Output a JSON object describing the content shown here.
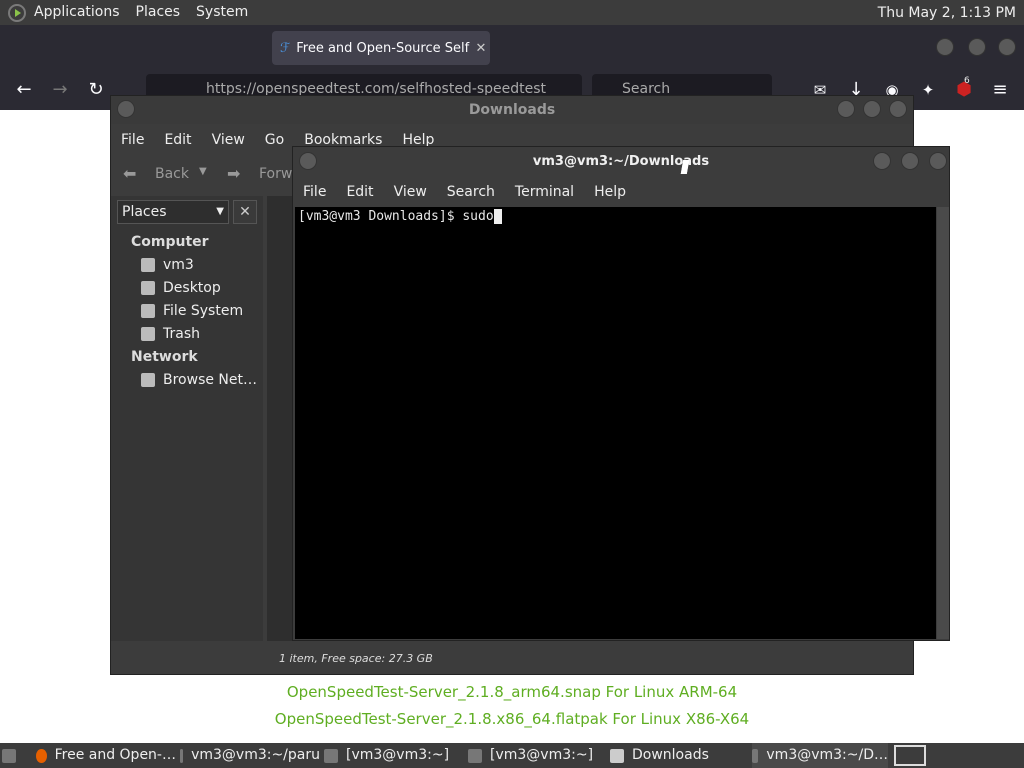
{
  "top_panel": {
    "menus": [
      "Applications",
      "Places",
      "System"
    ],
    "clock": "Thu May  2,  1:13 PM"
  },
  "firefox": {
    "tab_title": "Free and Open-Source Self",
    "tab_close": "✕",
    "url": "https://openspeedtest.com/selfhosted-speedtest",
    "search_placeholder": "Search",
    "badge": "6"
  },
  "page": {
    "links": [
      "OpenSpeedTest-Server_2.1.8_arm64.snap For Linux ARM-64",
      "OpenSpeedTest-Server_2.1.8.x86_64.flatpak For Linux X86-X64"
    ]
  },
  "file_manager": {
    "title": "Downloads",
    "menus": [
      "File",
      "Edit",
      "View",
      "Go",
      "Bookmarks",
      "Help"
    ],
    "back_label": "Back",
    "forward_label": "Forw",
    "places_select": "Places",
    "sidebar": {
      "computer_heading": "Computer",
      "computer_items": [
        "vm3",
        "Desktop",
        "File System",
        "Trash"
      ],
      "network_heading": "Network",
      "network_items": [
        "Browse Net…"
      ]
    },
    "status": "1 item, Free space: 27.3 GB"
  },
  "terminal": {
    "title": "vm3@vm3:~/Downloads",
    "menus": [
      "File",
      "Edit",
      "View",
      "Search",
      "Terminal",
      "Help"
    ],
    "prompt": "[vm3@vm3 Downloads]$ sudo"
  },
  "taskbar": {
    "tasks": [
      "Free and Open-…",
      "vm3@vm3:~/paru",
      "[vm3@vm3:~]",
      "[vm3@vm3:~]",
      "Downloads",
      "vm3@vm3:~/D…"
    ]
  }
}
